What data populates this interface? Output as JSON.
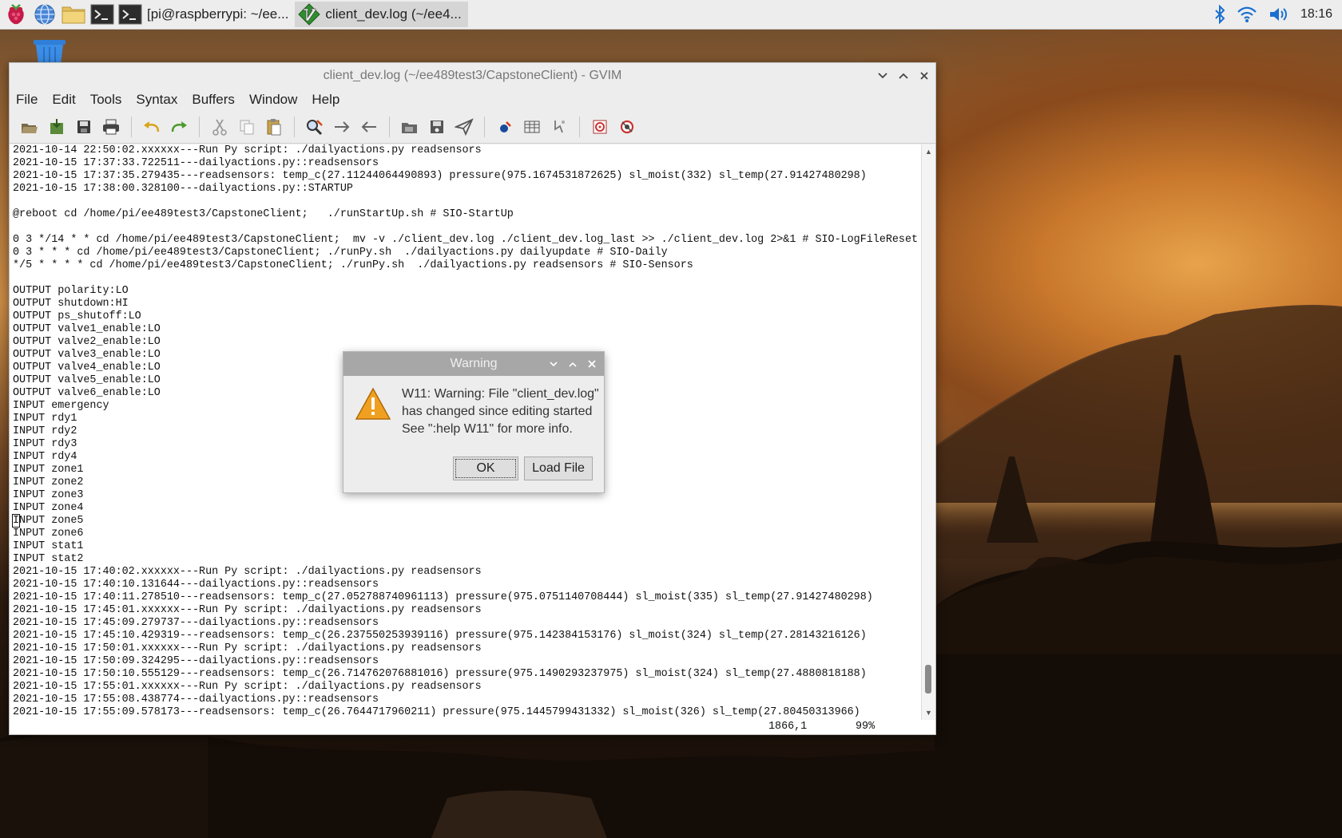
{
  "taskbar": {
    "tasks": [
      {
        "label": "[pi@raspberrypi: ~/ee..."
      },
      {
        "label": "client_dev.log (~/ee4..."
      }
    ],
    "clock": "18:16"
  },
  "gvim": {
    "title": "client_dev.log (~/ee489test3/CapstoneClient) - GVIM",
    "menu": [
      "File",
      "Edit",
      "Tools",
      "Syntax",
      "Buffers",
      "Window",
      "Help"
    ],
    "toolbar_icons": [
      "open-icon",
      "save-session-icon",
      "save-icon",
      "print-icon",
      "undo-icon",
      "redo-icon",
      "cut-icon",
      "copy-icon",
      "paste-icon",
      "find-replace-icon",
      "find-next-icon",
      "find-prev-icon",
      "load-session-icon",
      "save-session2-icon",
      "run-script-icon",
      "make-icon",
      "tags-icon",
      "jump-tag-icon",
      "help-icon",
      "find-help-icon"
    ],
    "lines": [
      "2021-10-14 22:50:02.xxxxxx---Run Py script: ./dailyactions.py readsensors",
      "2021-10-15 17:37:33.722511---dailyactions.py::readsensors",
      "2021-10-15 17:37:35.279435---readsensors: temp_c(27.11244064490893) pressure(975.1674531872625) sl_moist(332) sl_temp(27.91427480298)",
      "2021-10-15 17:38:00.328100---dailyactions.py::STARTUP",
      "",
      "@reboot cd /home/pi/ee489test3/CapstoneClient;   ./runStartUp.sh # SIO-StartUp",
      "",
      "0 3 */14 * * cd /home/pi/ee489test3/CapstoneClient;  mv -v ./client_dev.log ./client_dev.log_last >> ./client_dev.log 2>&1 # SIO-LogFileReset",
      "0 3 * * * cd /home/pi/ee489test3/CapstoneClient; ./runPy.sh  ./dailyactions.py dailyupdate # SIO-Daily",
      "*/5 * * * * cd /home/pi/ee489test3/CapstoneClient; ./runPy.sh  ./dailyactions.py readsensors # SIO-Sensors",
      "",
      "OUTPUT polarity:LO",
      "OUTPUT shutdown:HI",
      "OUTPUT ps_shutoff:LO",
      "OUTPUT valve1_enable:LO",
      "OUTPUT valve2_enable:LO",
      "OUTPUT valve3_enable:LO",
      "OUTPUT valve4_enable:LO",
      "OUTPUT valve5_enable:LO",
      "OUTPUT valve6_enable:LO",
      "INPUT emergency",
      "INPUT rdy1",
      "INPUT rdy2",
      "INPUT rdy3",
      "INPUT rdy4",
      "INPUT zone1",
      "INPUT zone2",
      "INPUT zone3",
      "INPUT zone4",
      "INPUT zone5",
      "INPUT zone6",
      "INPUT stat1",
      "INPUT stat2",
      "2021-10-15 17:40:02.xxxxxx---Run Py script: ./dailyactions.py readsensors",
      "2021-10-15 17:40:10.131644---dailyactions.py::readsensors",
      "2021-10-15 17:40:11.278510---readsensors: temp_c(27.052788740961113) pressure(975.0751140708444) sl_moist(335) sl_temp(27.91427480298)",
      "2021-10-15 17:45:01.xxxxxx---Run Py script: ./dailyactions.py readsensors",
      "2021-10-15 17:45:09.279737---dailyactions.py::readsensors",
      "2021-10-15 17:45:10.429319---readsensors: temp_c(26.237550253939116) pressure(975.142384153176) sl_moist(324) sl_temp(27.28143216126)",
      "2021-10-15 17:50:01.xxxxxx---Run Py script: ./dailyactions.py readsensors",
      "2021-10-15 17:50:09.324295---dailyactions.py::readsensors",
      "2021-10-15 17:50:10.555129---readsensors: temp_c(26.714762076881016) pressure(975.1490293237975) sl_moist(324) sl_temp(27.4880818188)",
      "2021-10-15 17:55:01.xxxxxx---Run Py script: ./dailyactions.py readsensors",
      "2021-10-15 17:55:08.438774---dailyactions.py::readsensors",
      "2021-10-15 17:55:09.578173---readsensors: temp_c(26.7644717960211) pressure(975.1445799431332) sl_moist(326) sl_temp(27.80450313966)"
    ],
    "cursor_line": 29,
    "ruler": "1866,1",
    "percent": "99%"
  },
  "dialog": {
    "title": "Warning",
    "message": [
      "W11: Warning: File \"client_dev.log\"",
      "has changed since editing started",
      "See \":help W11\" for more info."
    ],
    "ok_label": "OK",
    "load_label": "Load File"
  }
}
